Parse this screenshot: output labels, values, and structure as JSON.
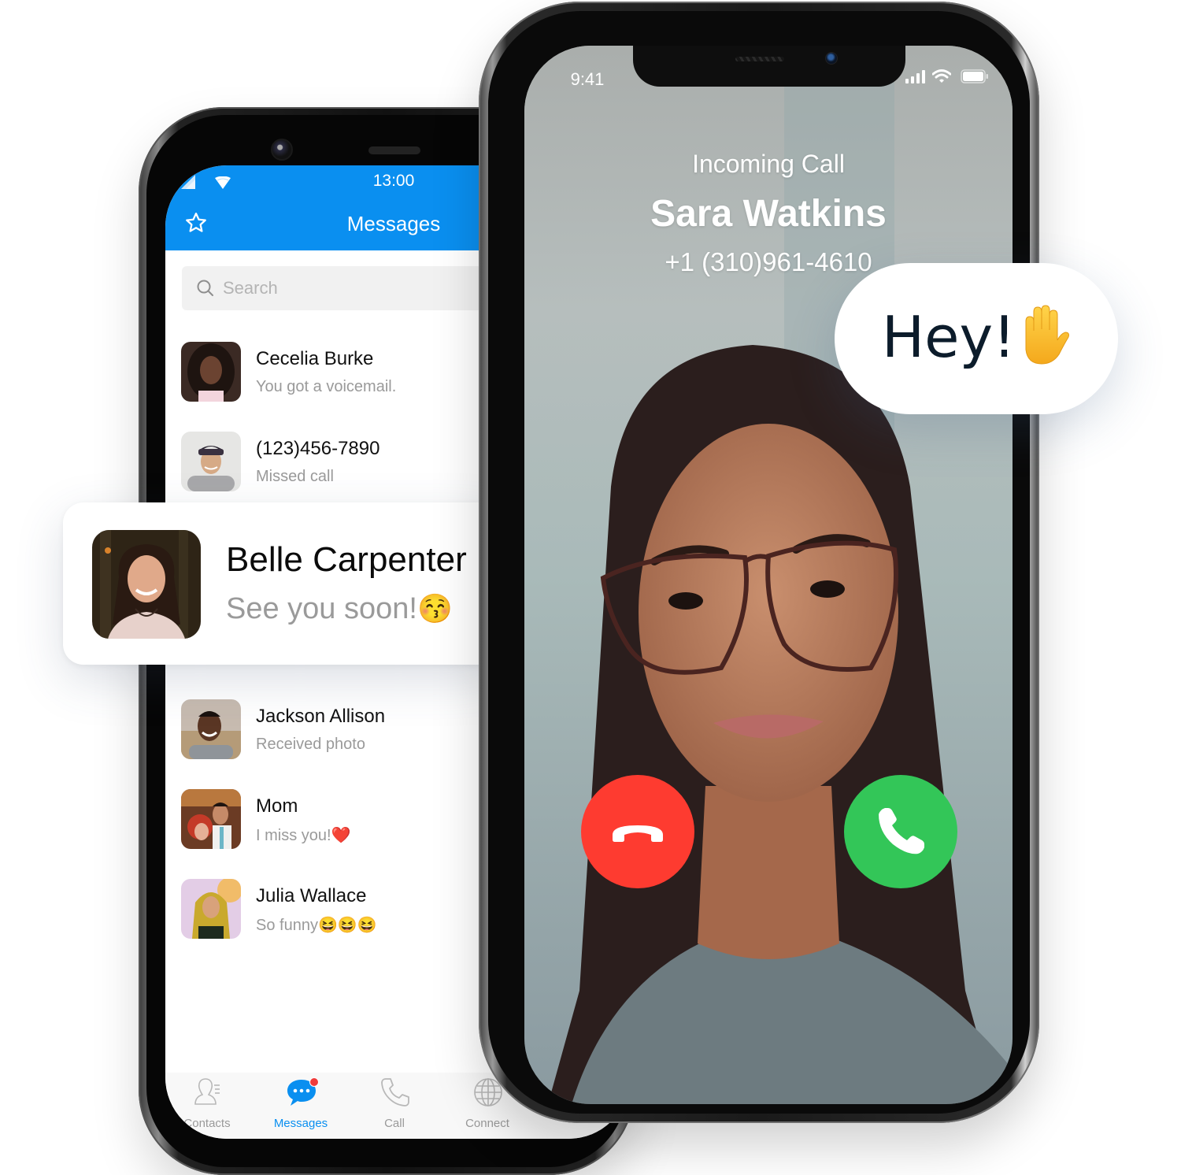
{
  "android": {
    "status": {
      "time": "13:00",
      "signal_icon": "cell-signal-icon",
      "wifi_icon": "wifi-icon"
    },
    "header": {
      "title": "Messages",
      "favorite_icon": "star-icon"
    },
    "search": {
      "placeholder": "Search",
      "value": "",
      "icon": "search-icon"
    },
    "conversations": [
      {
        "name": "Cecelia Burke",
        "preview": "You got a voicemail."
      },
      {
        "name": "(123)456-7890",
        "preview": "Missed call"
      },
      {
        "name": "Jackson Allison",
        "preview": "Received photo"
      },
      {
        "name": "Mom",
        "preview": "I miss you!",
        "emoji": "❤️"
      },
      {
        "name": "Julia Wallace",
        "preview": "So funny",
        "emoji": "😆😆😆"
      }
    ],
    "tabs": [
      {
        "label": "Contacts",
        "icon": "contacts-icon",
        "active": false
      },
      {
        "label": "Messages",
        "icon": "chat-bubble-icon",
        "active": true,
        "badge": true
      },
      {
        "label": "Call",
        "icon": "phone-icon",
        "active": false
      },
      {
        "label": "Connect",
        "icon": "globe-icon",
        "active": false
      }
    ]
  },
  "popup": {
    "name": "Belle Carpenter",
    "message": "See you soon!",
    "emoji": "😚"
  },
  "iphone": {
    "status": {
      "time": "9:41"
    },
    "call": {
      "label": "Incoming Call",
      "caller_name": "Sara Watkins",
      "caller_number": "+1 (310)961-4610",
      "decline_icon": "hang-up-icon",
      "accept_icon": "phone-icon"
    }
  },
  "bubble": {
    "text": "Hey!",
    "emoji": "✋"
  },
  "colors": {
    "brand_blue": "#0a8ff0",
    "decline_red": "#fe3b30",
    "accept_green": "#33c658",
    "badge_red": "#ef3b3b",
    "muted_text": "#9a9a9a"
  }
}
